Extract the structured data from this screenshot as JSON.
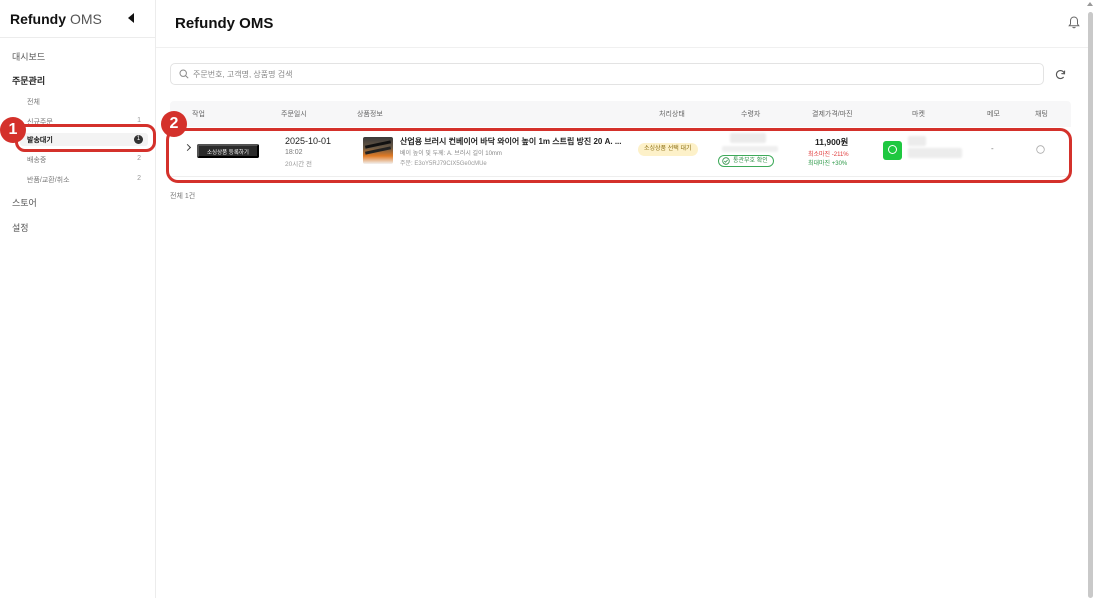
{
  "brand": {
    "bold": "Refundy",
    "light": "OMS"
  },
  "sidebar": {
    "dashboard": "대시보드",
    "orders_section": "주문관리",
    "sub_items": [
      {
        "label": "전체",
        "count": ""
      },
      {
        "label": "신규주문",
        "count": "1"
      },
      {
        "label": "발송대기",
        "count": "1"
      },
      {
        "label": "배송중",
        "count": "2"
      },
      {
        "label": "반품/교환/취소",
        "count": "2"
      }
    ],
    "store": "스토어",
    "settings": "설정"
  },
  "header": {
    "title": "Refundy OMS"
  },
  "search": {
    "placeholder": "주문번호, 고객명, 상품명 검색"
  },
  "table": {
    "columns": [
      "작업",
      "주문일시",
      "상품정보",
      "처리상태",
      "수령자",
      "결제가격/마진",
      "마켓",
      "메모",
      "채팅"
    ],
    "rows": [
      {
        "action_label": "소싱상품 등록하기",
        "date": "2025-10-01",
        "time": "18:02",
        "ago": "20시간 전",
        "product_name": "산업용 브러시 컨베이어 바닥 와이어 높이 1m 스트립 방진 20 A. ...",
        "product_option": "베이 높이 및 두께: A. 브러시 길이 10mm",
        "order_id": "주문: E3oY5RJ79CIX5Ge0cMUe",
        "status": "소싱상품 선택 대기",
        "customs": "통관부호 확인",
        "price": "11,900원",
        "min_margin": "최소마진 -211%",
        "max_margin": "최대마진 +30%",
        "memo": "-"
      }
    ]
  },
  "footer": {
    "total": "전체 1건"
  },
  "annotations": [
    "1",
    "2"
  ],
  "colors": {
    "annotation": "#d4312b",
    "market": "#1ec840",
    "status_badge_bg": "#fdf1c9"
  }
}
